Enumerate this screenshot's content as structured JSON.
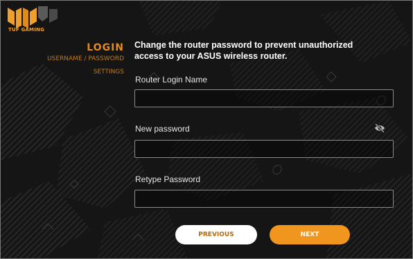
{
  "brand": "TUF GAMING",
  "sidebar": {
    "title": "LOGIN",
    "items": [
      "USERNAME / PASSWORD",
      "SETTINGS"
    ]
  },
  "heading": "Change the router password to prevent unauthorized access to your ASUS wireless router.",
  "fields": {
    "login_name": {
      "label": "Router Login Name",
      "value": ""
    },
    "new_password": {
      "label": "New password",
      "value": ""
    },
    "retype_password": {
      "label": "Retype Password",
      "value": ""
    }
  },
  "buttons": {
    "previous": "PREVIOUS",
    "next": "NEXT"
  },
  "icons": {
    "password_toggle": "eye-slash-icon",
    "logo": "tuf-gaming-logo"
  },
  "colors": {
    "accent": "#f0961e",
    "sidebar_title": "#e88a1a",
    "background": "#141414"
  }
}
